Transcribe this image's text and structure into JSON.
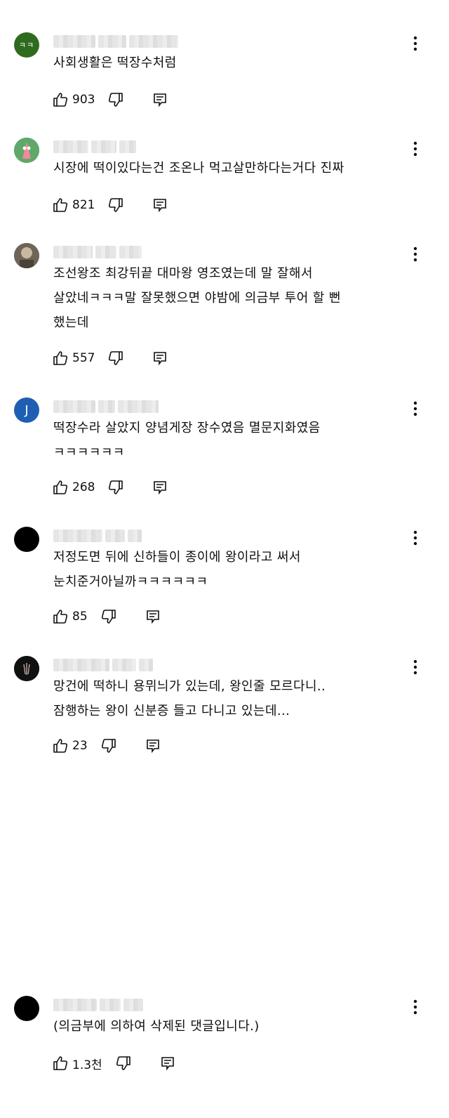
{
  "comments": [
    {
      "avatar_text": "ㅋㅋ",
      "avatar_color": "#2e6b1e",
      "text": "사회생활은 떡장수처럼",
      "likes": "903"
    },
    {
      "avatar_text": "",
      "avatar_color": "#3f8f4a",
      "text": "시장에 떡이있다는건 조온나 먹고살만하다는거다 진짜",
      "likes": "821"
    },
    {
      "avatar_text": "",
      "avatar_color": "#8a7f72",
      "text": "조선왕조 최강뒤끝 대마왕 영조였는데 말 잘해서\n살았네ㅋㅋㅋ말 잘못했으면 야밤에 의금부 투어 할 뻔\n했는데",
      "likes": "557"
    },
    {
      "avatar_text": "J",
      "avatar_color": "#1f5fb3",
      "text": "떡장수라 살았지 양념게장 장수였음 멸문지화였음\nㅋㅋㅋㅋㅋㅋ",
      "likes": "268"
    },
    {
      "avatar_text": "",
      "avatar_color": "#000000",
      "text": "저정도면 뒤에 신하들이 종이에 왕이라고 써서\n눈치준거아닐까ㅋㅋㅋㅋㅋㅋ",
      "likes": "85"
    },
    {
      "avatar_text": "",
      "avatar_color": "#111111",
      "text": "망건에 떡하니 용뮈늬가 있는데, 왕인줄 모르다니..\n잠행하는 왕이 신분증 들고 다니고 있는데...",
      "likes": "23"
    },
    {
      "avatar_text": "",
      "avatar_color": "#000000",
      "text": "(의금부에 의하여 삭제된 댓글입니다.)",
      "likes": "1.3천"
    }
  ]
}
